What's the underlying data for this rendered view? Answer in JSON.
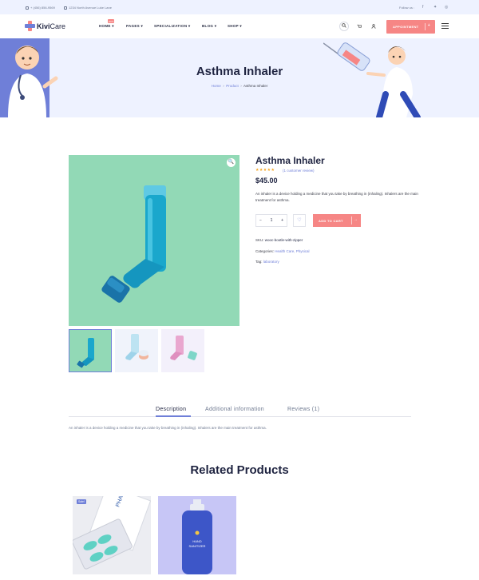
{
  "topbar": {
    "phone": "+ (456) 856-9569",
    "address": "1234 North Avenue Luke Lane",
    "follow_label": "Follow us :",
    "social_icons": [
      "facebook-icon",
      "twitter-icon",
      "instagram-icon"
    ]
  },
  "header": {
    "logo_part1": "Kivi",
    "logo_part2": "Care",
    "nav": [
      {
        "label": "HOME"
      },
      {
        "label": "PAGES"
      },
      {
        "label": "SPECIALIZATION"
      },
      {
        "label": "BLOG"
      },
      {
        "label": "SHOP"
      }
    ],
    "nav_badge": "HOT",
    "appointment_label": "APPOINTMENT",
    "colors": {
      "accent": "#f68685",
      "primary": "#6f7fd8",
      "dark": "#1e2340"
    }
  },
  "banner": {
    "title": "Asthma Inhaler",
    "breadcrumb": {
      "home": "Home",
      "product": "Product",
      "current": "Asthma Inhaler"
    }
  },
  "product": {
    "title": "Asthma Inhaler",
    "rating": 5,
    "stars": "★★★★★",
    "reviews_link": "(1 customer review)",
    "price": "$45.00",
    "short_description": "An inhaler is a device holding a medicine that you take by breathing in (inhaling). Inhalers are the main treatment for asthma.",
    "quantity": "1",
    "minus": "−",
    "plus": "+",
    "add_to_cart": "ADD TO CART",
    "sku_label": "SKU:",
    "sku_value": "wooc-bootle-with-zipper",
    "categories_label": "Categories:",
    "categories_value": "Health Care, Physical",
    "tag_label": "Tag:",
    "tag_value": "laboratory"
  },
  "tabs": {
    "items": [
      "Description",
      "Additional information",
      "Reviews (1)"
    ],
    "active": "Description",
    "description_text": "An inhaler is a device holding a medicine that you take by breathing in (inhaling). Inhalers are the main treatment for asthma."
  },
  "related": {
    "title": "Related Products",
    "sale_badge": "Sale!",
    "bottle_label_1": "HAND",
    "bottle_label_2": "SANITIZER",
    "box_label": "PHARMA"
  }
}
